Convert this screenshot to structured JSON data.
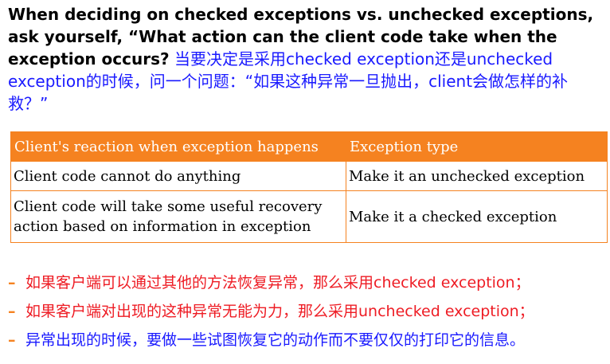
{
  "intro": {
    "en": "When deciding on checked exceptions vs. unchecked exceptions, ask yourself, “What action can the client code take when the exception occurs?",
    "zh": " 当要决定是采用checked exception还是unchecked exception的时候，问一个问题：“如果这种异常一旦抛出，client会做怎样的补救？”"
  },
  "table": {
    "headers": [
      "Client's reaction when exception happens",
      "Exception type"
    ],
    "rows": [
      [
        "Client code cannot do anything",
        "Make it an unchecked exception"
      ],
      [
        "Client code will take some useful recovery action based on information in exception",
        "Make it a checked exception"
      ]
    ]
  },
  "bullets": [
    "如果客户端可以通过其他的方法恢复异常，那么采用checked exception；",
    "如果客户端对出现的这种异常无能为力，那么采用unchecked exception；",
    "异常出现的时候，要做一些试图恢复它的动作而不要仅仅的打印它的信息。"
  ],
  "bullet_marker": "–",
  "colors": {
    "accent": "#f58220",
    "blue_text": "#1a1aff",
    "red_text": "#ee1c24"
  }
}
